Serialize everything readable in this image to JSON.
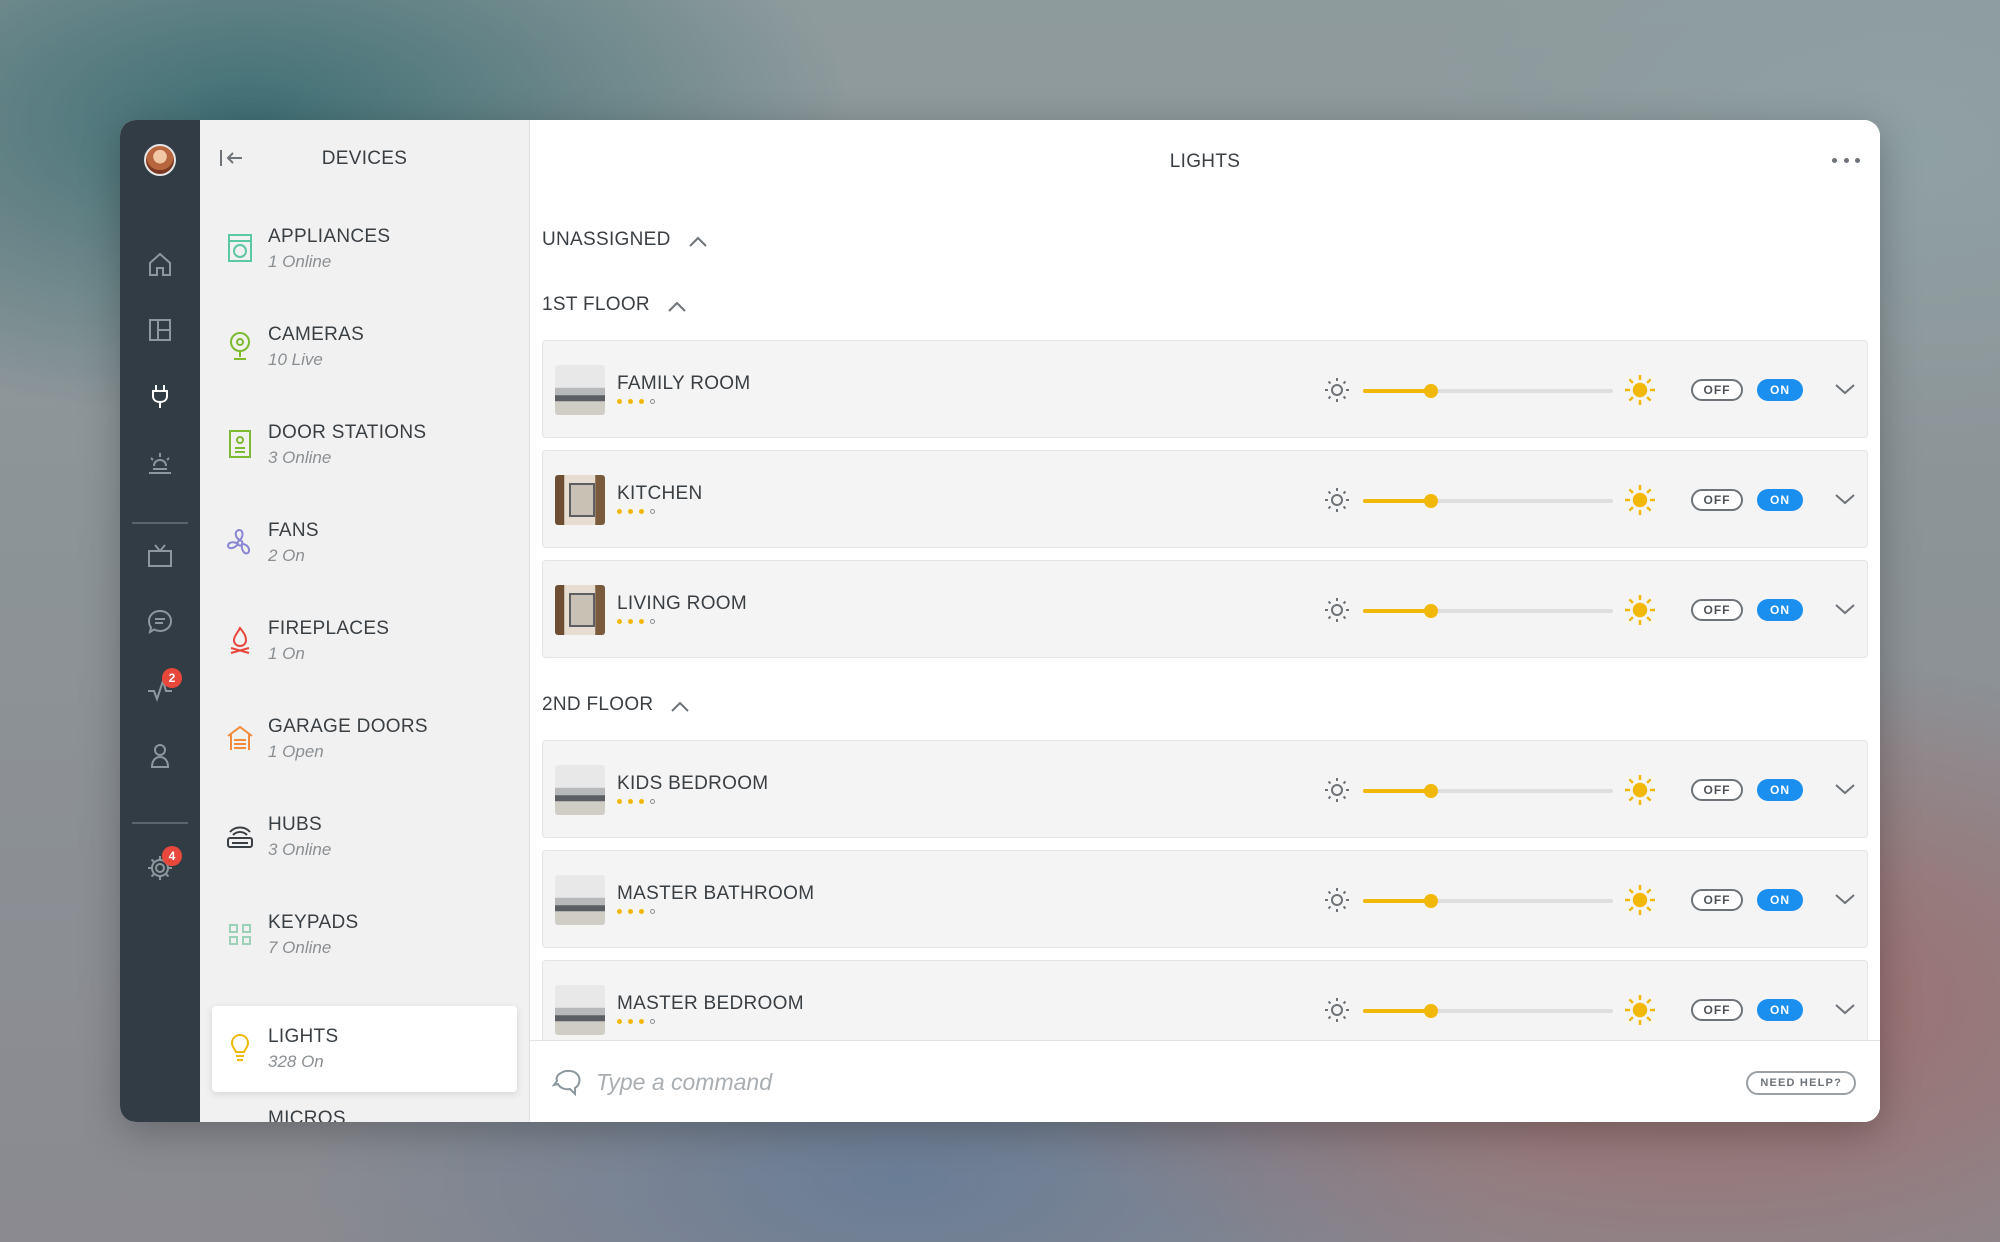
{
  "rail": {
    "notifications_badge": "2",
    "settings_badge": "4"
  },
  "devices": {
    "title": "DEVICES",
    "items": [
      {
        "name": "APPLIANCES",
        "status": "1 Online",
        "icon": "washer-icon"
      },
      {
        "name": "CAMERAS",
        "status": "10 Live",
        "icon": "camera-icon"
      },
      {
        "name": "DOOR STATIONS",
        "status": "3 Online",
        "icon": "door-station-icon"
      },
      {
        "name": "FANS",
        "status": "2 On",
        "icon": "fan-icon"
      },
      {
        "name": "FIREPLACES",
        "status": "1 On",
        "icon": "fireplace-icon"
      },
      {
        "name": "GARAGE DOORS",
        "status": "1 Open",
        "icon": "garage-icon"
      },
      {
        "name": "HUBS",
        "status": "3 Online",
        "icon": "hub-icon"
      },
      {
        "name": "KEYPADS",
        "status": "7 Online",
        "icon": "keypad-icon"
      },
      {
        "name": "LIGHTS",
        "status": "328 On",
        "icon": "lightbulb-icon"
      },
      {
        "name": "MICROS",
        "status": "",
        "icon": "micros-icon"
      }
    ]
  },
  "main": {
    "title": "LIGHTS",
    "groups": {
      "unassigned": "UNASSIGNED",
      "first_floor": "1ST FLOOR",
      "second_floor": "2ND FLOOR"
    },
    "rooms": [
      {
        "name": "FAMILY ROOM",
        "level": 0.27
      },
      {
        "name": "KITCHEN",
        "level": 0.27
      },
      {
        "name": "LIVING ROOM",
        "level": 0.27
      },
      {
        "name": "KIDS BEDROOM",
        "level": 0.27
      },
      {
        "name": "MASTER BATHROOM",
        "level": 0.27
      },
      {
        "name": "MASTER BEDROOM",
        "level": 0.27
      }
    ],
    "off_label": "OFF",
    "on_label": "ON"
  },
  "command": {
    "placeholder": "Type a command",
    "help_label": "NEED HELP?"
  },
  "colors": {
    "accent_yellow": "#f2b807",
    "on_blue": "#1a8ff0",
    "rail_bg": "#323c44",
    "badge_red": "#e8473c"
  }
}
